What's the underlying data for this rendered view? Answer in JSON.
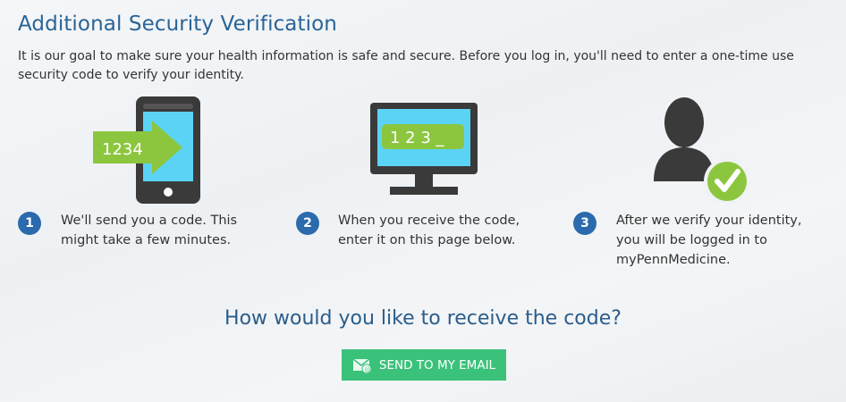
{
  "page": {
    "title": "Additional Security Verification",
    "intro": "It is our goal to make sure your health information is safe and secure. Before you log in, you'll need to enter a one-time use security code to verify your identity."
  },
  "illustrations": {
    "phone_code": "1234",
    "monitor_code": "1 2 3 _"
  },
  "steps": [
    {
      "number": "1",
      "line1": "We'll send you a code. This",
      "line2": "might take a few minutes.",
      "line3": "",
      "icon": "phone-icon"
    },
    {
      "number": "2",
      "line1": "When you receive the code,",
      "line2": "enter it on this page below.",
      "line3": "",
      "icon": "monitor-icon"
    },
    {
      "number": "3",
      "line1": "After we verify your identity,",
      "line2": "you will be logged in to",
      "line3": "myPennMedicine.",
      "icon": "verified-user-icon"
    }
  ],
  "question": "How would you like to receive the code?",
  "email_button": {
    "label": "SEND TO MY EMAIL",
    "icon": "email-icon"
  },
  "colors": {
    "title": "#2a6496",
    "step_badge": "#2a6aad",
    "button": "#3bc27a",
    "accent_green": "#8cc63f",
    "screen_cyan": "#5bd3f5",
    "device_dark": "#3a3a3a"
  }
}
